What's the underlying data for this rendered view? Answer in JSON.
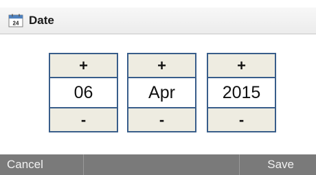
{
  "header": {
    "icon": "calendar-icon",
    "icon_day": "24",
    "title": "Date"
  },
  "spinners": [
    {
      "name": "day",
      "increment": "+",
      "value": "06",
      "decrement": "-"
    },
    {
      "name": "month",
      "increment": "+",
      "value": "Apr",
      "decrement": "-"
    },
    {
      "name": "year",
      "increment": "+",
      "value": "2015",
      "decrement": "-"
    }
  ],
  "softkeys": {
    "left": "Cancel",
    "middle": "",
    "right": "Save"
  },
  "colors": {
    "spinner_border": "#385d8a",
    "button_fill": "#eeece1",
    "softkey_bar": "#7a7a7a"
  }
}
